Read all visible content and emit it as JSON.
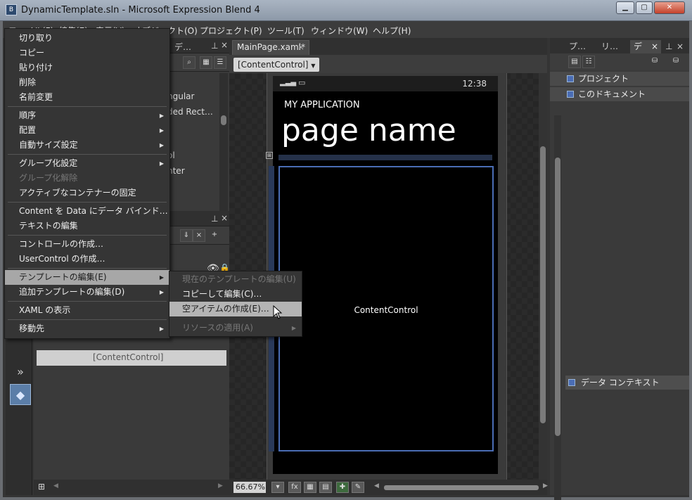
{
  "window": {
    "title": "DynamicTemplate.sln - Microsoft Expression Blend 4",
    "icon_glyph": "B"
  },
  "menubar": {
    "items": [
      "ファイル(F)",
      "編集(E)",
      "表示(V)",
      "オブジェクト(O)",
      "プロジェクト(P)",
      "ツール(T)",
      "ウィンドウ(W)",
      "ヘルプ(H)"
    ]
  },
  "left_panel": {
    "tab_fragment": "デ…",
    "tree_fragments": [
      "ngular",
      "ded Rect…",
      "ol",
      "nter"
    ],
    "obj_row": "[ContentControl]"
  },
  "document": {
    "tab_label": "MainPage.xaml*",
    "breadcrumb": "[ContentControl]",
    "phone_time": "12:38",
    "app_title": "MY APPLICATION",
    "page_name": "page name",
    "content_label": "ContentControl",
    "zoom": "66.67%"
  },
  "right_panel": {
    "tabs": [
      "プ…",
      "リ…",
      "デ"
    ],
    "items": [
      "プロジェクト",
      "このドキュメント"
    ],
    "data_context": "データ コンテキスト"
  },
  "context_menu": {
    "items": [
      {
        "label": "切り取り"
      },
      {
        "label": "コピー"
      },
      {
        "label": "貼り付け"
      },
      {
        "label": "削除"
      },
      {
        "label": "名前変更"
      },
      {
        "label": "順序"
      },
      {
        "label": "配置"
      },
      {
        "label": "自動サイズ設定"
      },
      {
        "label": "グループ化設定"
      },
      {
        "label": "グループ化解除"
      },
      {
        "label": "アクティブなコンテナーの固定"
      },
      {
        "label": "Content を Data にデータ バインド…"
      },
      {
        "label": "テキストの編集"
      },
      {
        "label": "コントロールの作成…"
      },
      {
        "label": "UserControl の作成…"
      },
      {
        "label": "テンプレートの編集(E)"
      },
      {
        "label": "追加テンプレートの編集(D)"
      },
      {
        "label": "XAML の表示"
      },
      {
        "label": "移動先"
      }
    ]
  },
  "submenu": {
    "items": [
      {
        "label": "現在のテンプレートの編集(U)"
      },
      {
        "label": "コピーして編集(C)…"
      },
      {
        "label": "空アイテムの作成(E)…"
      },
      {
        "label": "リソースの適用(A)"
      }
    ]
  },
  "colors": {
    "accent": "#4a6db5",
    "menu_bg": "#353535",
    "highlight": "#a7a7a7"
  }
}
